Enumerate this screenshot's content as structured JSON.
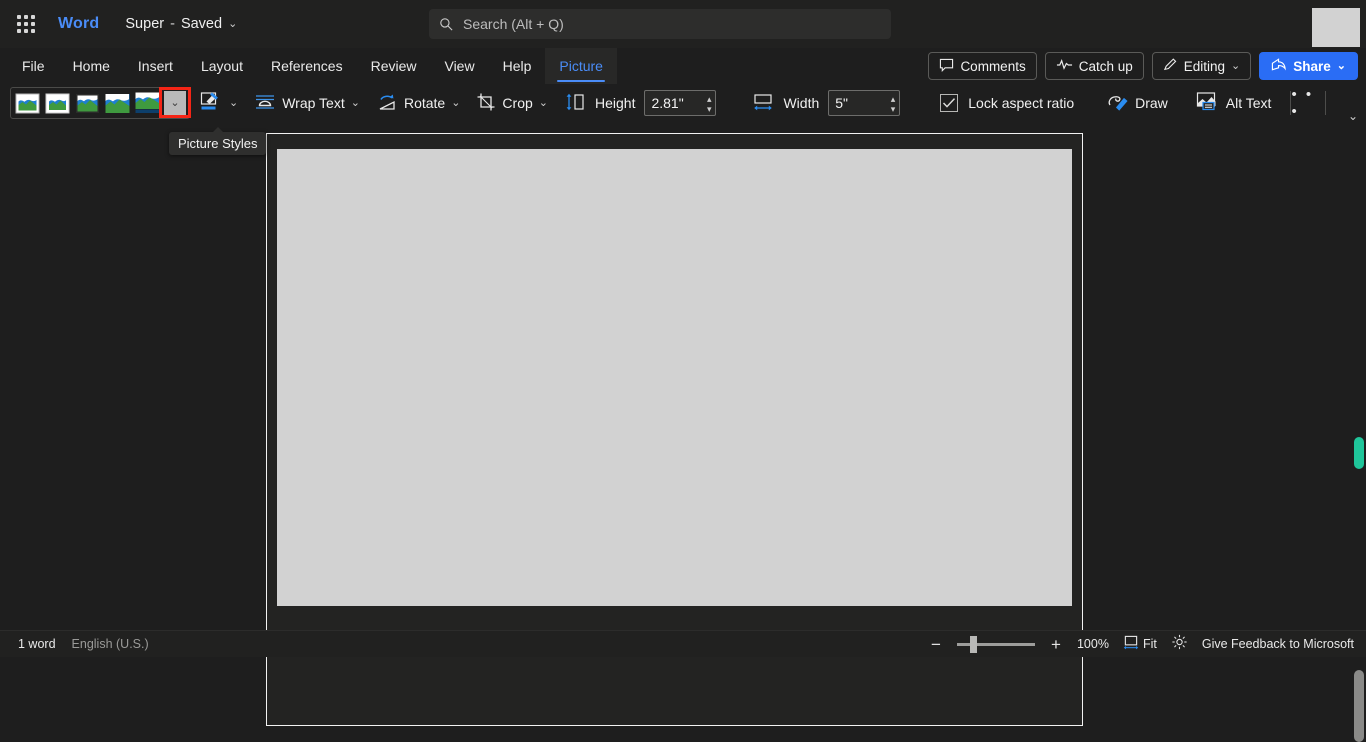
{
  "titlebar": {
    "app_launcher_icon": "waffle-grid-icon",
    "app_name": "Word",
    "doc_name": "Super",
    "doc_separator": "-",
    "doc_status": "Saved",
    "doc_chevron": "⌄",
    "search": {
      "icon": "search-icon",
      "placeholder": "Search (Alt + Q)",
      "value": ""
    },
    "avatar": "user-avatar"
  },
  "tabs": [
    {
      "label": "File",
      "active": false
    },
    {
      "label": "Home",
      "active": false
    },
    {
      "label": "Insert",
      "active": false
    },
    {
      "label": "Layout",
      "active": false
    },
    {
      "label": "References",
      "active": false
    },
    {
      "label": "Review",
      "active": false
    },
    {
      "label": "View",
      "active": false
    },
    {
      "label": "Help",
      "active": false
    },
    {
      "label": "Picture",
      "active": true
    }
  ],
  "tab_actions": {
    "comments": {
      "label": "Comments",
      "icon": "comment-bubble-icon"
    },
    "catch_up": {
      "label": "Catch up",
      "icon": "activity-wave-icon"
    },
    "editing": {
      "label": "Editing",
      "icon": "pencil-icon",
      "chevron": "⌄"
    },
    "share": {
      "label": "Share",
      "icon": "share-arrow-icon",
      "chevron": "⌄",
      "color": "#2a6df5"
    }
  },
  "commandbar": {
    "picture_styles": {
      "gallery_name": "Picture Styles",
      "thumbnails": [
        "picture-style-1",
        "picture-style-2",
        "picture-style-3",
        "picture-style-4",
        "picture-style-5"
      ],
      "dropdown_chevron": "⌄",
      "highlight_color": "#f52516",
      "highlighted": true
    },
    "picture_border": {
      "icon": "picture-border-pen-icon",
      "chevron": "⌄"
    },
    "wrap_text": {
      "label": "Wrap Text",
      "icon": "wrap-text-icon",
      "chevron": "⌄"
    },
    "rotate": {
      "label": "Rotate",
      "icon": "rotate-icon",
      "chevron": "⌄"
    },
    "crop": {
      "label": "Crop",
      "icon": "crop-icon",
      "chevron": "⌄"
    },
    "height": {
      "label": "Height",
      "icon": "height-arrow-icon",
      "value": "2.81\""
    },
    "width": {
      "label": "Width",
      "icon": "width-arrow-icon",
      "value": "5\""
    },
    "lock_aspect_ratio": {
      "label": "Lock aspect ratio",
      "checked": true,
      "check_glyph": "✓"
    },
    "draw": {
      "label": "Draw",
      "icon": "draw-pen-icon"
    },
    "alt_text": {
      "label": "Alt Text",
      "icon": "alt-text-icon"
    },
    "overflow": {
      "label": "• • •",
      "name": "more-options"
    },
    "collapse_ribbon": {
      "chevron": "⌄"
    }
  },
  "tooltip": {
    "text": "Picture Styles",
    "visible": true
  },
  "document": {
    "page_background": "#232322",
    "image_placeholder_color": "#d2d2d2",
    "content": ""
  },
  "statusbar": {
    "word_count": "1 word",
    "language": "English (U.S.)",
    "zoom_minus": "−",
    "zoom_plus": "+",
    "zoom_level": "100%",
    "fit": {
      "label": "Fit",
      "icon": "fit-page-icon"
    },
    "focus": {
      "icon": "focus-brightness-icon"
    },
    "feedback": "Give Feedback to Microsoft"
  },
  "scrollbars": {
    "vertical_accent_color": "#1fc59a",
    "vertical_thumb_color": "#8a8a88"
  }
}
